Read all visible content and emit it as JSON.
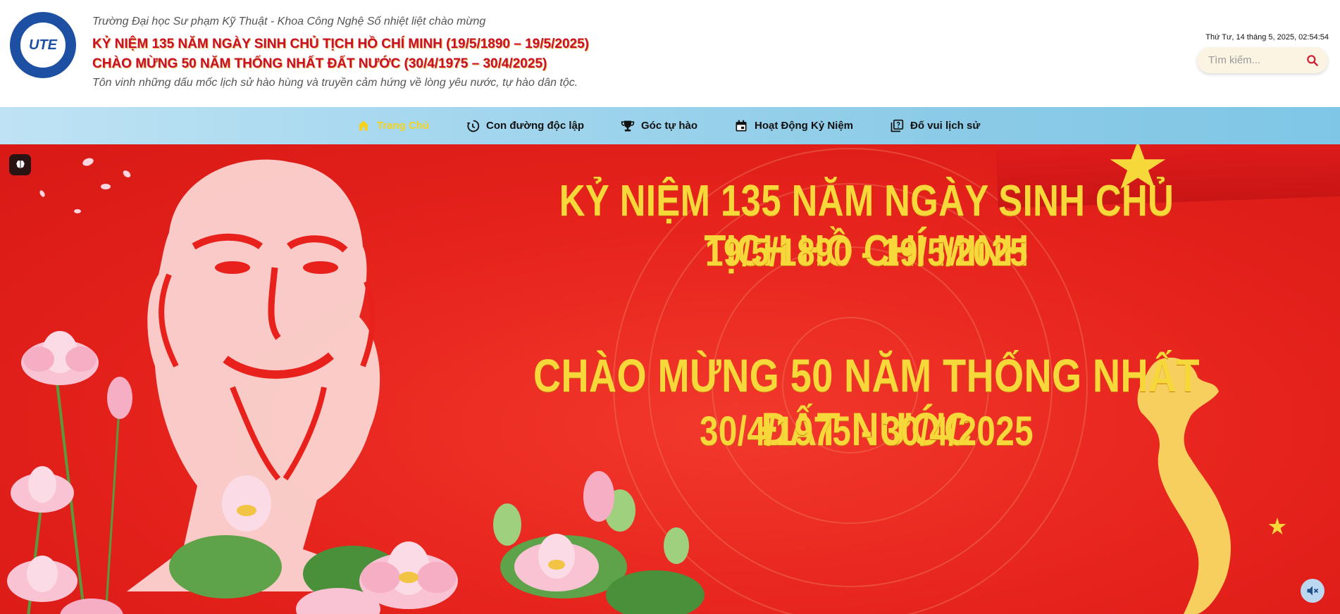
{
  "header": {
    "logo_text": "UTE",
    "welcome": "Trường Đại học Sư phạm Kỹ Thuật - Khoa Công Nghệ Số nhiệt liệt chào mừng",
    "headline_1": "KỶ NIỆM 135 NĂM NGÀY SINH CHỦ TỊCH HỒ CHÍ MINH (19/5/1890 – 19/5/2025)",
    "headline_2": "CHÀO MỪNG 50 NĂM THỐNG NHẤT ĐẤT NƯỚC (30/4/1975 – 30/4/2025)",
    "subtitle": "Tôn vinh những dấu mốc lịch sử hào hùng và truyền cảm hứng về lòng yêu nước, tự hào dân tộc.",
    "datetime": "Thứ Tư, 14 tháng 5, 2025, 02:54:54",
    "search_placeholder": "Tìm kiếm..."
  },
  "nav": {
    "items": [
      {
        "label": "Trang Chủ",
        "icon": "home-icon",
        "active": true
      },
      {
        "label": "Con đường độc lập",
        "icon": "history-icon",
        "active": false
      },
      {
        "label": "Góc tự hào",
        "icon": "trophy-icon",
        "active": false
      },
      {
        "label": "Hoạt Động Kỷ Niệm",
        "icon": "calendar-icon",
        "active": false
      },
      {
        "label": "Đố vui lịch sử",
        "icon": "quiz-icon",
        "active": false
      }
    ]
  },
  "banner": {
    "line_1": "KỶ NIỆM 135 NĂM NGÀY SINH CHỦ TỊCH HỒ CHÍ MINH",
    "line_2": "19/5/1890 - 19/5/2025",
    "line_3": "CHÀO MỪNG 50 NĂM THỐNG NHẤT ĐẤT NƯỚC",
    "line_4": "30/4/1975 - 30/4/2025"
  },
  "colors": {
    "primary_red": "#c8102e",
    "banner_red": "#e9211d",
    "banner_yellow": "#f7d83b",
    "nav_active": "#f5d31a"
  }
}
